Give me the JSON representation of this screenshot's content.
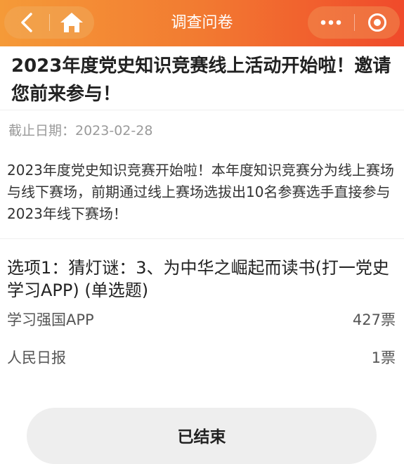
{
  "navbar": {
    "title": "调查问卷",
    "back_icon": "chevron-left-icon",
    "home_icon": "home-icon",
    "more_icon": "more-dots-icon",
    "target_icon": "target-circle-icon",
    "gradient_colors": [
      "#f59a38",
      "#f04a2b"
    ]
  },
  "survey": {
    "title": "2023年度党史知识竞赛线上活动开始啦！邀请您前来参与！",
    "deadline": "截止日期：2023-02-28",
    "description": "2023年度党史知识竞赛开始啦！本年度知识竞赛分为线上赛场与线下赛场，前期通过线上赛场选拔出10名参赛选手直接参与2023年线下赛场！"
  },
  "question": {
    "text": "选项1：猜灯谜：3、为中华之崛起而读书(打一党史学习APP) (单选题)",
    "options": [
      {
        "label": "学习强国APP",
        "votes": "427票"
      },
      {
        "label": "人民日报",
        "votes": "1票"
      }
    ]
  },
  "footer": {
    "button_label": "已结束"
  }
}
